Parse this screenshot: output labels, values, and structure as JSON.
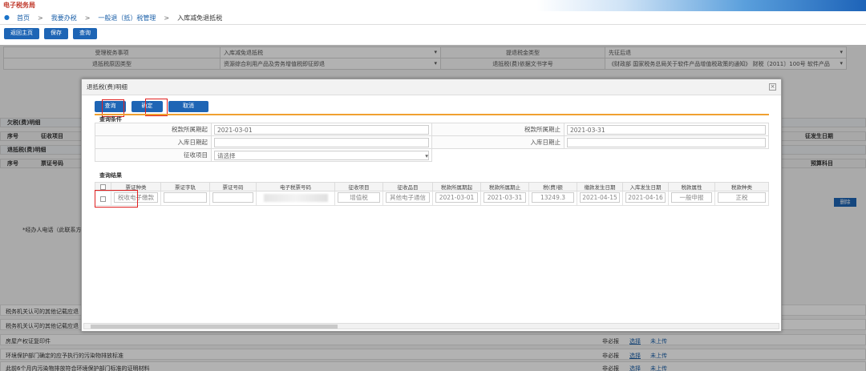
{
  "header": {
    "logo_text": "电子税务局",
    "breadcrumb": [
      "首页",
      "我要办税",
      "一般退（抵）税管理",
      "入库减免退抵税"
    ],
    "sep": ">"
  },
  "toolbar": {
    "back": "返回主页",
    "save": "保存",
    "query": "查询"
  },
  "bg_form": {
    "r1": [
      "受理税务事项",
      "入库减免退抵税",
      "提退税金类型",
      "先征后退"
    ],
    "r2": [
      "退抵税原因类型",
      "资源综合利用产品及劳务增值税即征即退",
      "退抵税(费)依据文书字号",
      "《财政部 国家税务总局关于软件产品增值税政策的通知》 财税〔2011〕100号 软件产品"
    ]
  },
  "bg_sections": {
    "owed": "欠税(费)明细",
    "owed_cols": [
      "序号",
      "征收项目"
    ],
    "owed_right": "征发生日期",
    "refund": "退抵税(费)明细",
    "refund_cols": [
      "序号",
      "票证号码"
    ],
    "refund_right": "预算科目",
    "delete": "删除",
    "agent_phone": "*经办人电话（此联系方"
  },
  "bg_rows": [
    {
      "label": "税务机关认可的其他记载应退",
      "flag": "",
      "pick": "",
      "up": ""
    },
    {
      "label": "税务机关认可的其他记载应退",
      "flag": "",
      "pick": "",
      "up": ""
    },
    {
      "label": "房屋产权证复印件",
      "flag": "非必报",
      "pick": "选择",
      "up": "未上传"
    },
    {
      "label": "环境保护部门确定的应予执行的污染物排放标准",
      "flag": "非必报",
      "pick": "选择",
      "up": "未上传"
    },
    {
      "label": "此前6个月内污染物排放符合环境保护部门标准的证明材料",
      "flag": "非必报",
      "pick": "选择",
      "up": "未上传"
    }
  ],
  "dialog": {
    "title": "退抵税(费)明细",
    "buttons": {
      "query": "查询",
      "confirm": "确定",
      "cancel": "取消"
    },
    "query_section": "查询条件",
    "fields": {
      "period_start_label": "税款所属期起",
      "period_start": "2021-03-01",
      "period_end_label": "税款所属期止",
      "period_end": "2021-03-31",
      "stock_start_label": "入库日期起",
      "stock_start": "",
      "stock_end_label": "入库日期止",
      "stock_end": "",
      "levy_label": "征收项目",
      "levy_value": "请选择"
    },
    "result_section": "查询结果",
    "columns": [
      "票证种类",
      "票证字轨",
      "票证号码",
      "电子税票号码",
      "征收项目",
      "征收品目",
      "税款所属期起",
      "税款所属期止",
      "税(费)额",
      "缴款发生日期",
      "入库发生日期",
      "税款属性",
      "税款种类"
    ],
    "row": [
      "税收电子缴款",
      "",
      "",
      "",
      "增值税",
      "其他电子通信",
      "2021-03-01",
      "2021-03-31",
      "13249.3",
      "2021-04-15",
      "2021-04-16",
      "一般申报",
      "正税"
    ]
  }
}
